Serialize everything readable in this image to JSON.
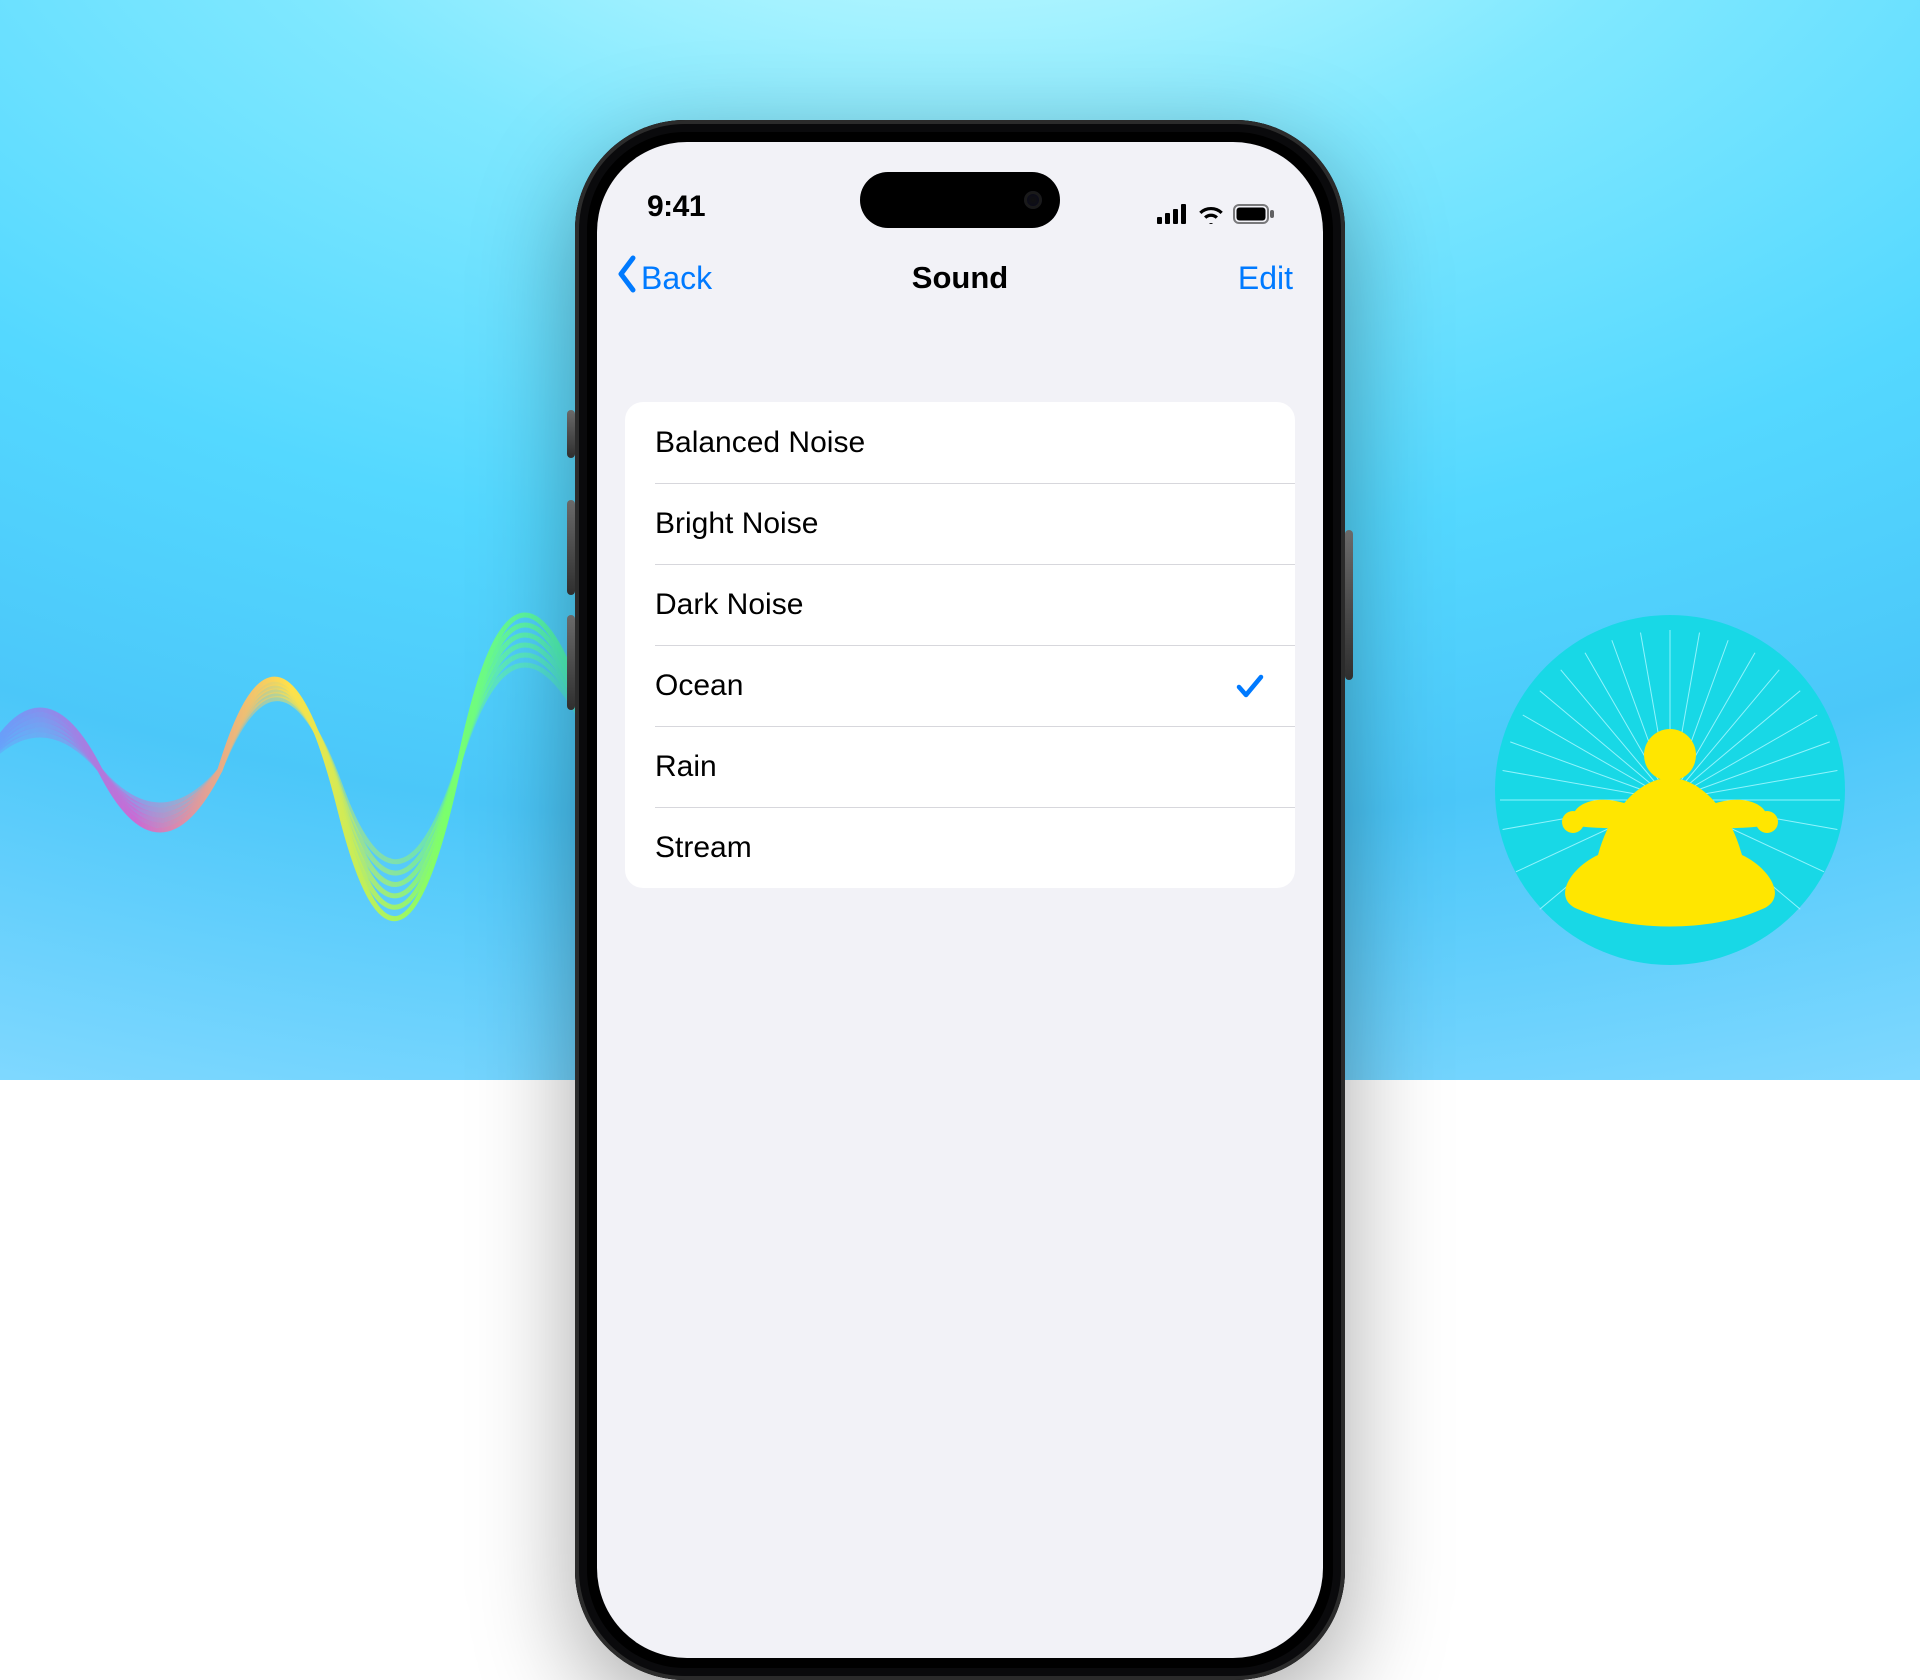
{
  "status": {
    "time": "9:41"
  },
  "nav": {
    "back_label": "Back",
    "title": "Sound",
    "edit_label": "Edit"
  },
  "sounds": {
    "items": [
      {
        "label": "Balanced Noise",
        "selected": false
      },
      {
        "label": "Bright Noise",
        "selected": false
      },
      {
        "label": "Dark Noise",
        "selected": false
      },
      {
        "label": "Ocean",
        "selected": true
      },
      {
        "label": "Rain",
        "selected": false
      },
      {
        "label": "Stream",
        "selected": false
      }
    ]
  },
  "colors": {
    "accent": "#007aff"
  }
}
